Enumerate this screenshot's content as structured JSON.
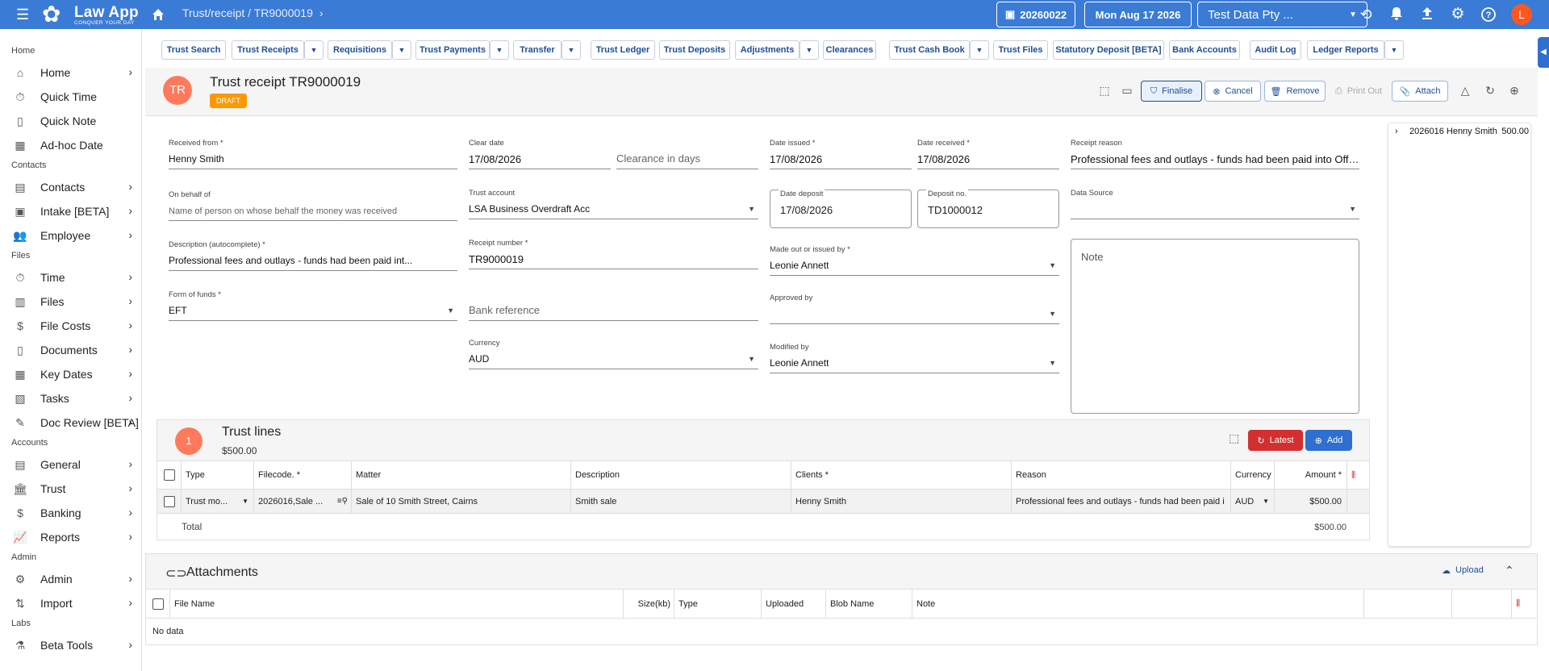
{
  "app": {
    "name": "Law App",
    "tagline": "CONQUER YOUR DAY",
    "accent": "#3a7bd5"
  },
  "topbar": {
    "breadcrumb": "Trust/receipt / TR9000019",
    "period": "20260022",
    "date": "Mon Aug 17 2026",
    "company": "Test Data Pty ...",
    "user_initial": "L",
    "icons": [
      "history-icon",
      "bell-icon",
      "upload-icon",
      "gear-icon",
      "help-icon"
    ]
  },
  "sidebar": {
    "sections": [
      "Home",
      "Contacts",
      "Files",
      "Accounts",
      "Admin",
      "Labs"
    ],
    "items": [
      {
        "label": "Home",
        "icon": "home-icon"
      },
      {
        "label": "Quick Time",
        "icon": "stopwatch-icon"
      },
      {
        "label": "Quick Note",
        "icon": "note-icon"
      },
      {
        "label": "Ad-hoc Date",
        "icon": "calendar-icon"
      },
      {
        "label": "Contacts",
        "icon": "contacts-icon"
      },
      {
        "label": "Intake [BETA]",
        "icon": "intake-icon"
      },
      {
        "label": "Employee",
        "icon": "employee-icon"
      },
      {
        "label": "Time",
        "icon": "stopwatch-icon"
      },
      {
        "label": "Files",
        "icon": "files-icon"
      },
      {
        "label": "File Costs",
        "icon": "file-costs-icon"
      },
      {
        "label": "Documents",
        "icon": "document-icon"
      },
      {
        "label": "Key Dates",
        "icon": "calendar-icon"
      },
      {
        "label": "Tasks",
        "icon": "tasks-icon"
      },
      {
        "label": "Doc Review [BETA]",
        "icon": "doc-review-icon"
      },
      {
        "label": "General",
        "icon": "general-icon"
      },
      {
        "label": "Trust",
        "icon": "bank-icon"
      },
      {
        "label": "Banking",
        "icon": "banking-icon"
      },
      {
        "label": "Reports",
        "icon": "reports-icon"
      },
      {
        "label": "Admin",
        "icon": "admin-icon"
      },
      {
        "label": "Import",
        "icon": "import-icon"
      },
      {
        "label": "Beta Tools",
        "icon": "flask-icon"
      }
    ]
  },
  "subtabs": [
    "Trust Search",
    "Trust Receipts",
    "Requisitions",
    "Trust Payments",
    "Transfer",
    "Trust Ledger",
    "Trust Deposits",
    "Adjustments",
    "Clearances",
    "Trust Cash Book",
    "Trust Files",
    "Statutory Deposit [BETA]",
    "Bank Accounts",
    "Audit Log",
    "Ledger Reports"
  ],
  "record": {
    "initials": "TR",
    "title": "Trust receipt TR9000019",
    "status": "DRAFT",
    "actions": {
      "finalise": "Finalise",
      "cancel": "Cancel",
      "remove": "Remove",
      "print": "Print Out",
      "attach": "Attach"
    }
  },
  "form": {
    "received_from": {
      "label": "Received from *",
      "value": "Henny Smith"
    },
    "on_behalf_of": {
      "label": "On behalf of",
      "placeholder": "Name of person on whose behalf the money was received"
    },
    "description": {
      "label": "Description (autocomplete) *",
      "value": "Professional fees and outlays - funds had been paid int..."
    },
    "form_of_funds": {
      "label": "Form of funds *",
      "value": "EFT"
    },
    "clear_date": {
      "label": "Clear date",
      "value": "17/08/2026"
    },
    "clearance_days": {
      "placeholder": "Clearance in days"
    },
    "trust_account": {
      "label": "Trust account",
      "value": "LSA Business Overdraft Acc"
    },
    "receipt_number": {
      "label": "Receipt number *",
      "value": "TR9000019"
    },
    "bank_reference": {
      "placeholder": "Bank reference"
    },
    "currency": {
      "label": "Currency",
      "value": "AUD"
    },
    "date_issued": {
      "label": "Date issued *",
      "value": "17/08/2026"
    },
    "date_received": {
      "label": "Date received *",
      "value": "17/08/2026"
    },
    "date_deposit": {
      "label": "Date deposit",
      "value": "17/08/2026"
    },
    "deposit_no": {
      "label": "Deposit no.",
      "value": "TD1000012"
    },
    "made_out_by": {
      "label": "Made out or issued by *",
      "value": "Leonie Annett"
    },
    "approved_by": {
      "label": "Approved by",
      "value": ""
    },
    "modified_by": {
      "label": "Modified by",
      "value": "Leonie Annett"
    },
    "receipt_reason": {
      "label": "Receipt reason",
      "value": "Professional fees and outlays - funds had been paid into Office"
    },
    "data_source": {
      "label": "Data Source",
      "value": ""
    },
    "note": {
      "placeholder": "Note"
    }
  },
  "sidetree": {
    "file": "2026016 Henny Smith",
    "amount": "500.00"
  },
  "trust_lines": {
    "count": "1",
    "title": "Trust lines",
    "total": "$500.00",
    "latest": "Latest",
    "add": "Add",
    "columns": [
      "Type",
      "Filecode. *",
      "Matter",
      "Description",
      "Clients *",
      "Reason",
      "Currency",
      "Amount *"
    ],
    "rows": [
      {
        "type": "Trust mo...",
        "filecode": "2026016,Sale ...",
        "matter": "Sale of 10 Smith Street, Cairns",
        "description": "Smith sale",
        "clients": "Henny Smith",
        "reason": "Professional fees and outlays - funds had been paid i",
        "currency": "AUD",
        "amount": "$500.00"
      }
    ],
    "total_label": "Total",
    "total_amount": "$500.00"
  },
  "attachments": {
    "title": "Attachments",
    "upload": "Upload",
    "columns": [
      "File Name",
      "Size(kb)",
      "Type",
      "Uploaded",
      "Blob Name",
      "Note"
    ],
    "empty": "No data"
  }
}
